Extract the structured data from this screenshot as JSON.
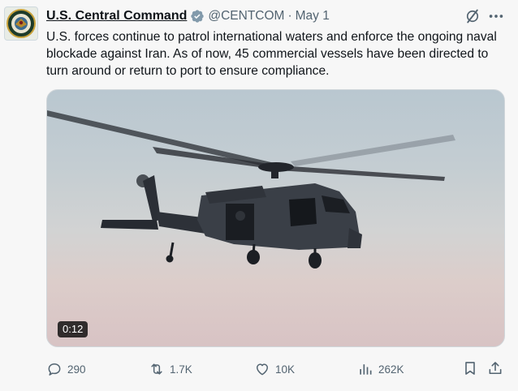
{
  "author": {
    "name": "U.S. Central Command",
    "handle": "@CENTCOM",
    "separator": "·",
    "date": "May 1",
    "verified_icon": "verified-badge-icon",
    "avatar_icon": "centcom-seal"
  },
  "tweet": {
    "text": "U.S. forces continue to patrol international waters and enforce the ongoing naval blockade against Iran. As of now, 45 commercial vessels have been directed to turn around or return to port to ensure compliance."
  },
  "media": {
    "type": "video",
    "subject": "helicopter",
    "duration": "0:12"
  },
  "actions": {
    "replies": "290",
    "reposts": "1.7K",
    "likes": "10K",
    "views": "262K"
  },
  "colors": {
    "text": "#0f1419",
    "muted": "#536471",
    "verified": "#829aab",
    "background": "#f7f7f7"
  }
}
